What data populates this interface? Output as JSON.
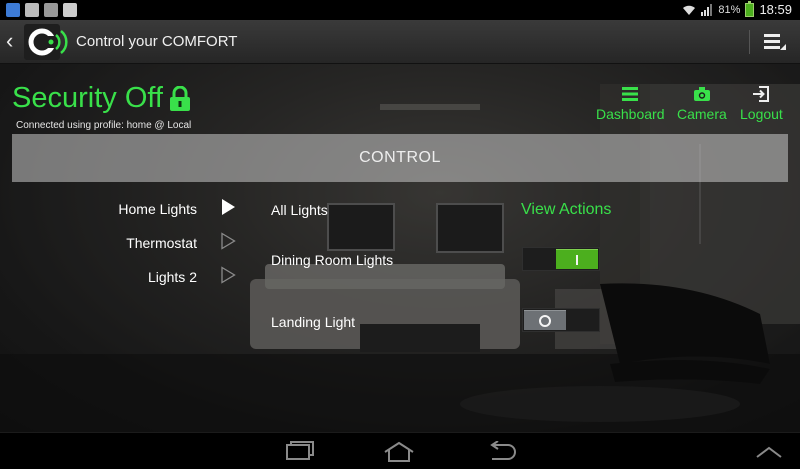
{
  "status_bar": {
    "battery_text": "81%",
    "time": "18:59"
  },
  "app": {
    "title": "Control your COMFORT"
  },
  "security": {
    "status": "Security Off",
    "profile_text": "Connected using profile: home @ Local"
  },
  "top_nav": [
    {
      "label": "Dashboard",
      "icon": "hamburger-icon"
    },
    {
      "label": "Camera",
      "icon": "camera-icon"
    },
    {
      "label": "Logout",
      "icon": "logout-icon"
    }
  ],
  "section": {
    "title": "CONTROL"
  },
  "categories": [
    {
      "label": "Home Lights",
      "selected": true
    },
    {
      "label": "Thermostat",
      "selected": false
    },
    {
      "label": "Lights 2",
      "selected": false
    }
  ],
  "devices": {
    "all_label": "All Lights",
    "view_actions": "View Actions",
    "items": [
      {
        "label": "Dining Room Lights",
        "state": "on"
      },
      {
        "label": "Landing Light",
        "state": "off"
      }
    ]
  },
  "colors": {
    "accent": "#39e04a",
    "toggle_on": "#4caf1e",
    "toggle_off": "#6d7175"
  }
}
